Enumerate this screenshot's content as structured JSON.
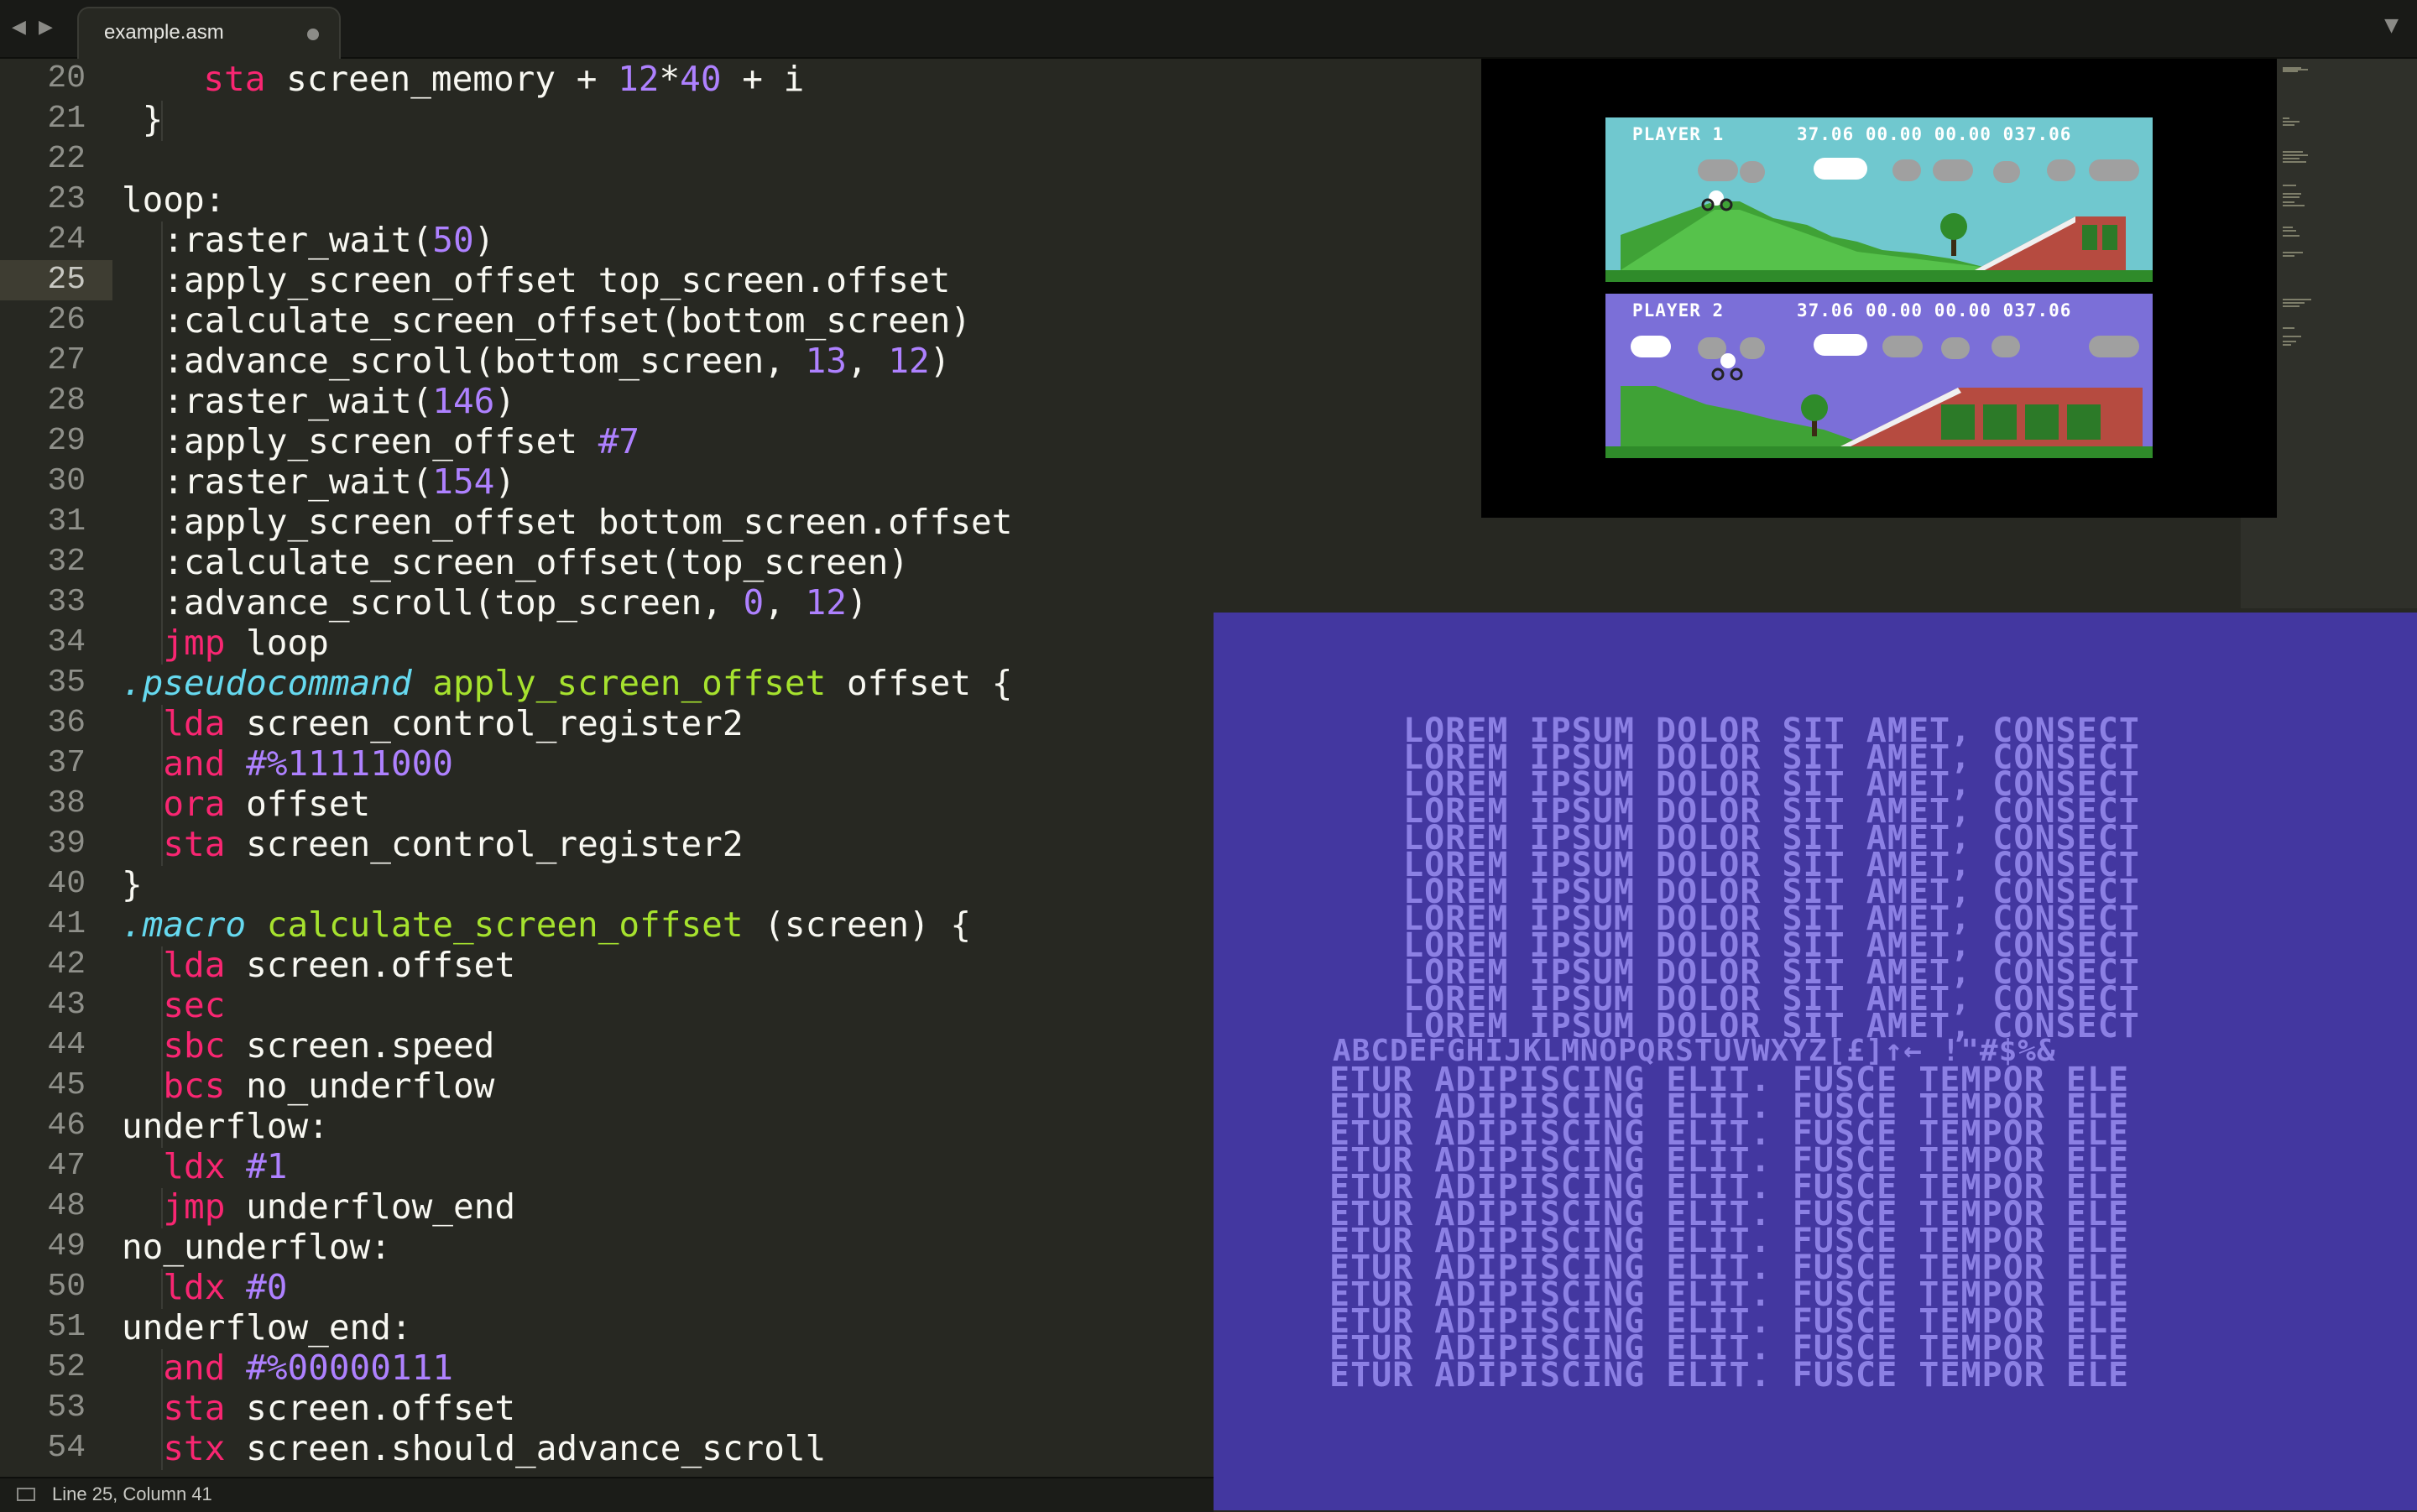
{
  "tabbar": {
    "back_glyph": "◀",
    "forward_glyph": "▶",
    "menu_glyph": "▼",
    "tab_title": "example.asm"
  },
  "editor": {
    "line_numbers": [
      "20",
      "21",
      "22",
      "23",
      "24",
      "25",
      "26",
      "27",
      "28",
      "29",
      "30",
      "31",
      "32",
      "33",
      "34",
      "35",
      "36",
      "37",
      "38",
      "39",
      "40",
      "41",
      "42",
      "43",
      "44",
      "45",
      "46",
      "47",
      "48",
      "49",
      "50",
      "51",
      "52",
      "53",
      "54"
    ],
    "active_line": "25"
  },
  "game": {
    "player1_label": "PLAYER 1",
    "player1_times": "37.06 00.00 00.00 037.06",
    "player2_label": "PLAYER 2",
    "player2_times": "37.06 00.00 00.00 037.06"
  },
  "c64": {
    "lorem_line": "LOREM IPSUM DOLOR SIT AMET, CONSECT",
    "charset_line": "ABCDEFGHIJKLMNOPQRSTUVWXYZ[£]↑← !\"#$%&",
    "etur_line": "ETUR ADIPISCING ELIT. FUSCE TEMPOR ELE"
  },
  "status": {
    "text": "Line 25, Column 41"
  },
  "colors": {
    "background": "#272822",
    "keyword": "#f92672",
    "number": "#ae81ff",
    "directive": "#66d9ef",
    "function": "#a6e22e",
    "c64_background": "#4337a0",
    "c64_text": "#8c80e4"
  }
}
